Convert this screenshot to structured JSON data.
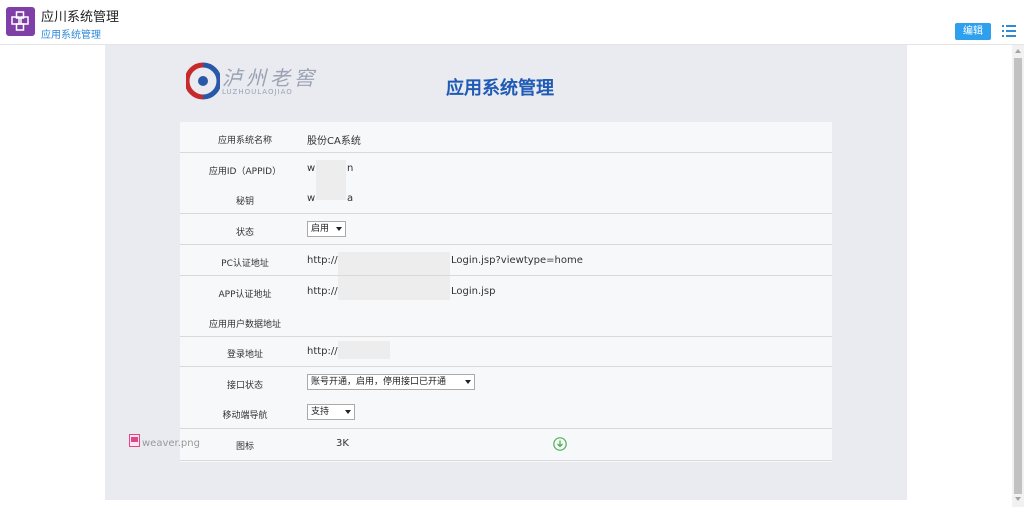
{
  "header": {
    "app_title": "应川系统管理",
    "breadcrumb": "应用系统管理",
    "edit_label": "编辑"
  },
  "main": {
    "logo_text": "泸州老窖",
    "logo_sub": "LUZHOULAOJIAO",
    "page_title": "应用系统管理"
  },
  "form": {
    "rows": [
      {
        "label": "应用系统名称",
        "value": "股份CA系统"
      },
      {
        "label": "应用ID（APPID）",
        "value_prefix": "w",
        "value_suffix": "n"
      },
      {
        "label": "秘钥",
        "value_prefix": "w",
        "value_suffix": "a"
      },
      {
        "label": "状态",
        "select": "启用"
      },
      {
        "label": "PC认证地址",
        "value_prefix": "http://",
        "value_suffix": "Login.jsp?viewtype=home"
      },
      {
        "label": "APP认证地址",
        "value_prefix": "http://",
        "value_suffix": "Login.jsp"
      },
      {
        "label": "应用用户数据地址",
        "value": ""
      },
      {
        "label": "登录地址",
        "value_prefix": "http://"
      },
      {
        "label": "接口状态",
        "select": "账号开通，启用，停用接口已开通"
      },
      {
        "label": "移动端导航",
        "select": "支持"
      },
      {
        "label": "图标",
        "file_name": "weaver.png",
        "file_size": "3K"
      }
    ]
  },
  "colors": {
    "brand_purple": "#7e3fa6",
    "accent_blue": "#2fa0ee",
    "title_blue": "#1f5bb4",
    "download_green": "#4caf50"
  },
  "icons": [
    "app-logo-icon",
    "menu-list-icon",
    "file-image-icon",
    "download-icon"
  ]
}
